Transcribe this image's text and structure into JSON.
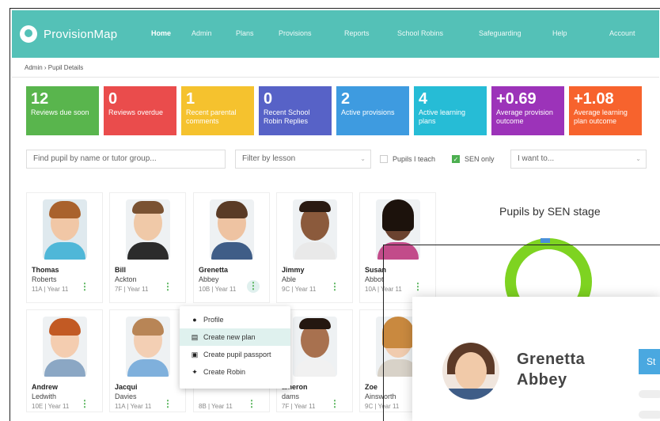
{
  "app": {
    "logo_text": "ProvisionMap"
  },
  "nav": {
    "items": [
      "Home",
      "Admin",
      "Plans",
      "Provisions",
      "Reports",
      "School Robins",
      "Safeguarding",
      "Help",
      "Account"
    ]
  },
  "breadcrumb": "Admin › Pupil Details",
  "tiles": [
    {
      "num": "12",
      "label": "Reviews due soon",
      "color": "#59b54d"
    },
    {
      "num": "0",
      "label": "Reviews overdue",
      "color": "#ea4c4c"
    },
    {
      "num": "1",
      "label": "Recent parental comments",
      "color": "#f5c22e"
    },
    {
      "num": "0",
      "label": "Recent School Robin Replies",
      "color": "#5762c7"
    },
    {
      "num": "2",
      "label": "Active provisions",
      "color": "#3e9be0"
    },
    {
      "num": "4",
      "label": "Active learning plans",
      "color": "#26bcd6"
    },
    {
      "num": "+0.69",
      "label": "Average provision outcome",
      "color": "#9c33b9"
    },
    {
      "num": "+1.08",
      "label": "Average learning plan outcome",
      "color": "#f7632d"
    }
  ],
  "filters": {
    "search_placeholder": "Find pupil by name or tutor group...",
    "lesson_placeholder": "Filter by lesson",
    "pupils_i_teach": "Pupils I teach",
    "sen_only": "SEN only",
    "i_want_to": "I want to..."
  },
  "pupils": [
    {
      "first": "Thomas",
      "last": "Roberts",
      "meta": "11A | Year 11"
    },
    {
      "first": "Bill",
      "last": "Ackton",
      "meta": "7F | Year 11"
    },
    {
      "first": "Grenetta",
      "last": "Abbey",
      "meta": "10B | Year 11"
    },
    {
      "first": "Jimmy",
      "last": "Able",
      "meta": "9C | Year 11"
    },
    {
      "first": "Susan",
      "last": "Abbot",
      "meta": "10A | Year 11"
    },
    {
      "first": "Andrew",
      "last": "Ledwith",
      "meta": "10E | Year 11"
    },
    {
      "first": "Jacqui",
      "last": "Davies",
      "meta": "11A | Year 11"
    },
    {
      "first": "",
      "last": "",
      "meta": "8B | Year 11"
    },
    {
      "first": "ameron",
      "last": "dams",
      "meta": "7F | Year 11"
    },
    {
      "first": "Zoe",
      "last": "Ainsworth",
      "meta": "9C | Year 11"
    }
  ],
  "sen_chart": {
    "title": "Pupils by SEN stage"
  },
  "context_menu": [
    "Profile",
    "Create new plan",
    "Create pupil passport",
    "Create Robin"
  ],
  "popup": {
    "first": "Grenetta",
    "last": "Abbey",
    "button": "St"
  }
}
